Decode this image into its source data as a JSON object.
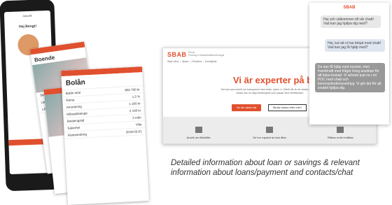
{
  "phone_back": {
    "greeting": "Hej Bengt!",
    "top": "Aktuellt"
  },
  "card_boende": {
    "title": "Boende",
    "rows": [
      "Skriv ut",
      "Uppgifter",
      "Lån"
    ]
  },
  "card_loans": {
    "title": "Bolån",
    "rows": [
      [
        "Bolån total",
        "850 700 kr"
      ],
      [
        "Ränta",
        "1,5 %"
      ],
      [
        "Amortering",
        "1 200 kr"
      ],
      [
        "Månadsbelopp",
        "2 100 kr"
      ],
      [
        "Bindningstid",
        "3 mån"
      ],
      [
        "Säkerhet",
        "Villa"
      ],
      [
        "Ränteändring",
        "2018-03-01"
      ]
    ]
  },
  "browser": {
    "brand": "SBAB",
    "brand_sub": "Privat\nFöretag & Bostadsrättsföreningar",
    "nav": "Start   Låna ⌄   Spara ⌄   Försäkra ⌄   Kundtjänst",
    "hero": "Vi är experter på bolån",
    "hero_sub": "Det ska vara enkelt och transparent med bolån, tycker vi. Därför får du ett räntan direkt och sedan kan du välja bindningstid som passar dina förhållanden.",
    "btn_primary": "Se din ränta här",
    "btn_secondary": "Binda räntan eller inte?",
    "strip": [
      "Ansök om lånelöfte",
      "Se hur mycket du kan låna",
      "Räkna ut din bolånta"
    ]
  },
  "chat": {
    "header": "SBAB",
    "msg1": "Hej och välkommen till vår chatt! Vad kan jag hjälpa dig med?",
    "msg2": "Hej, kul att ni har börjat med chatt! Vad kan jag få hjälp med?",
    "msg3": "Du kan få hjälp med mycket, men framförallt med frågor kring ansökan för att köpa bostad. Vi arbetar just nu i en POC med chatt och kommunikationsverktyg. Vi gör det för att snabbt hjälpa dig."
  },
  "caption": "Detailed information about loan or savings & relevant information about loans/payment and contacts/chat"
}
